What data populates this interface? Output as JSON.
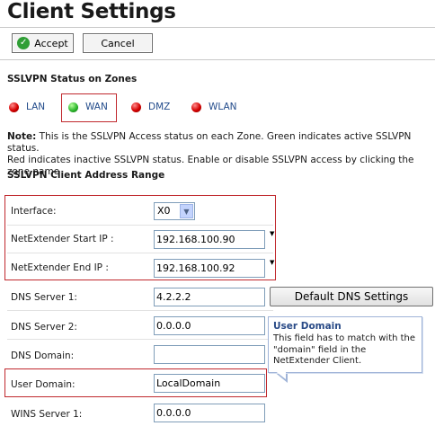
{
  "page": {
    "title": "Client Settings"
  },
  "toolbar": {
    "accept_label": "Accept",
    "cancel_label": "Cancel"
  },
  "status": {
    "heading": "SSLVPN Status on Zones",
    "zones": [
      {
        "label": "LAN",
        "state": "red"
      },
      {
        "label": "WAN",
        "state": "green"
      },
      {
        "label": "DMZ",
        "state": "red"
      },
      {
        "label": "WLAN",
        "state": "red"
      }
    ],
    "note_prefix": "Note:",
    "note_line1": " This is the SSLVPN Access status on each Zone. Green indicates active SSLVPN status.",
    "note_line2": "Red indicates inactive SSLVPN status. Enable or disable SSLVPN access by clicking the zone name"
  },
  "range": {
    "heading": "SSLVPN Client Address Range",
    "interface_label": "Interface:",
    "interface_value": "X0",
    "start_label": "NetExtender Start IP :",
    "start_value": "192.168.100.90",
    "end_label": "NetExtender End IP :",
    "end_value": "192.168.100.92",
    "dns1_label": "DNS Server 1:",
    "dns1_value": "4.2.2.2",
    "dns2_label": "DNS Server 2:",
    "dns2_value": "0.0.0.0",
    "dnsdomain_label": "DNS Domain:",
    "dnsdomain_value": "",
    "userdomain_label": "User Domain:",
    "userdomain_value": "LocalDomain",
    "wins1_label": "WINS Server 1:",
    "wins1_value": "0.0.0.0",
    "default_dns_button": "Default DNS Settings"
  },
  "tooltip": {
    "title": "User Domain",
    "body": "This field has to match with the \"domain\" field in the NetExtender Client."
  },
  "colors": {
    "highlight_border": "#c0282d",
    "link": "#224b8b",
    "active": "#2eb82e",
    "inactive": "#d40000"
  }
}
